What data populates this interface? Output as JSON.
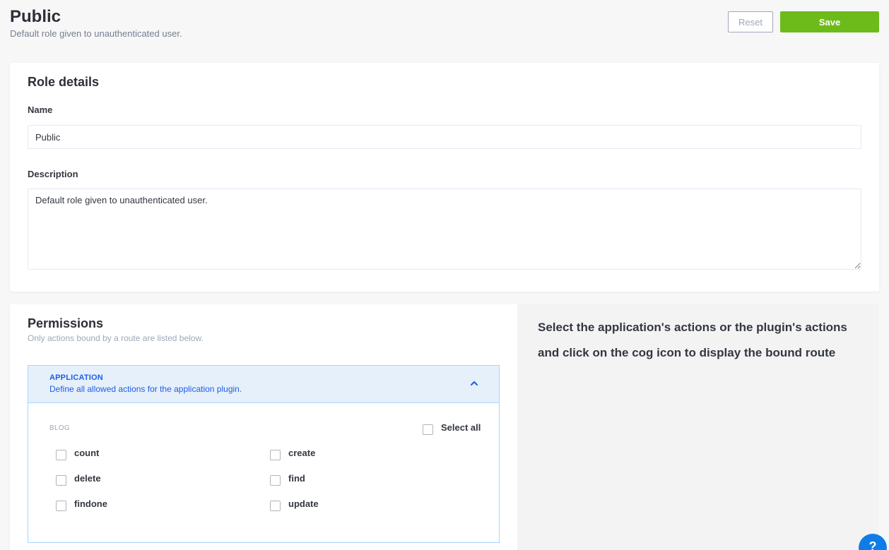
{
  "header": {
    "title": "Public",
    "subtitle": "Default role given to unauthenticated user."
  },
  "actions": {
    "reset_label": "Reset",
    "save_label": "Save"
  },
  "role_details": {
    "title": "Role details",
    "name_label": "Name",
    "name_value": "Public",
    "description_label": "Description",
    "description_value": "Default role given to unauthenticated user."
  },
  "permissions": {
    "title": "Permissions",
    "subtitle": "Only actions bound by a route are listed below.",
    "plugin": {
      "name": "APPLICATION",
      "description": "Define all allowed actions for the application plugin.",
      "controller": "BLOG",
      "select_all_label": "Select all",
      "actions": [
        {
          "label": "count",
          "checked": false
        },
        {
          "label": "create",
          "checked": false
        },
        {
          "label": "delete",
          "checked": false
        },
        {
          "label": "find",
          "checked": false
        },
        {
          "label": "findone",
          "checked": false
        },
        {
          "label": "update",
          "checked": false
        }
      ]
    }
  },
  "info_panel": {
    "text": "Select the application's actions or the plugin's actions and click on the cog icon to display the bound route"
  },
  "help": {
    "label": "?"
  },
  "colors": {
    "save": "#6dbb1a",
    "accent": "#1c5de7",
    "plugin_bg": "#e6f0fb",
    "help": "#0e7de7"
  }
}
